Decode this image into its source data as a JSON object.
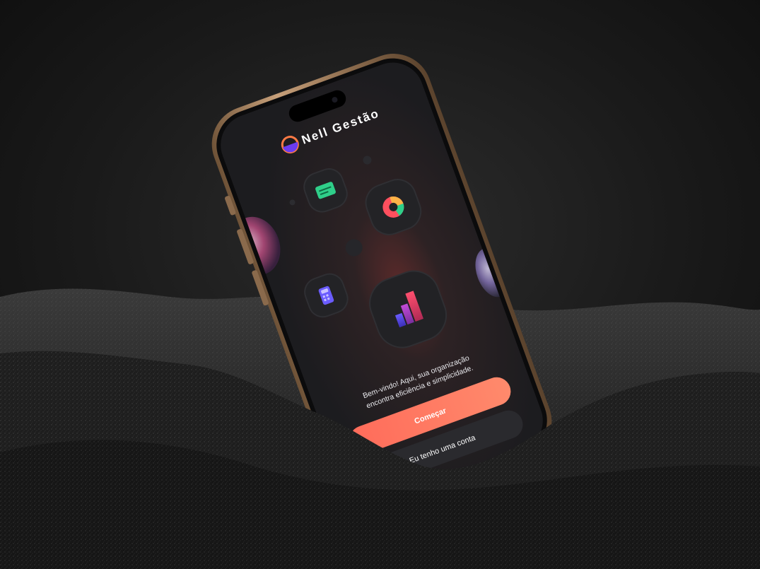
{
  "app": {
    "name": "Nell Gestão",
    "welcome_line1": "Bem-vindo! Aqui, sua organização",
    "welcome_line2": "encontra eficiência e simplicidade.",
    "primary_button": "Começar",
    "secondary_button": "Eu tenho uma conta"
  },
  "colors": {
    "accent": "#ff6a55",
    "logo_purple": "#6b3cf0",
    "logo_orange": "#ff7a45",
    "frame_gold": "#a8835f",
    "screen_bg": "#1c1c1f"
  },
  "icons": [
    "logo-icon",
    "wallet-icon",
    "pie-chart-icon",
    "calculator-icon",
    "bar-chart-icon"
  ]
}
